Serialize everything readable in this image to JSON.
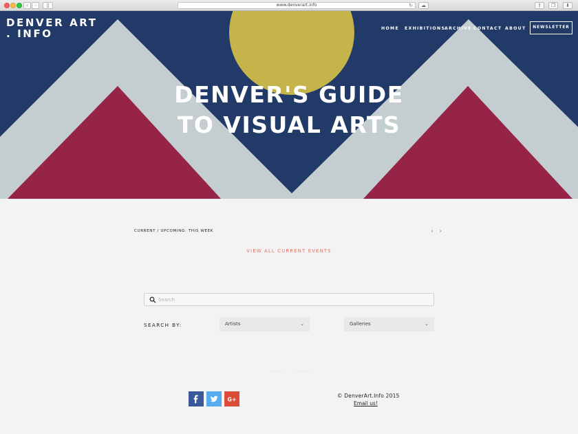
{
  "browser": {
    "url": "www.denverart.info"
  },
  "header": {
    "logo": "DENVER ART . INFO",
    "nav": [
      "HOME",
      "EXHIBITIONS",
      "ARCHIVE",
      "CONTACT",
      "ABOUT"
    ],
    "newsletter_label": "NEWSLETTER"
  },
  "hero": {
    "title_line1": "DENVER'S GUIDE",
    "title_line2": "TO VISUAL ARTS",
    "colors": {
      "sky": "#213a68",
      "sun": "#c4b44a",
      "mountain_outer": "#c4cdd0",
      "mountain_inner": "#962446"
    }
  },
  "events": {
    "label": "CURRENT / UPCOMING: THIS WEEK",
    "prev_icon": "chevron-left-icon",
    "next_icon": "chevron-right-icon",
    "view_all_label": "VIEW ALL CURRENT EVENTS"
  },
  "search": {
    "placeholder": "Search",
    "value": "",
    "search_by_label": "SEARCH BY:",
    "dropdowns": [
      {
        "selected": "Artists"
      },
      {
        "selected": "Galleries"
      }
    ]
  },
  "footer": {
    "ghost_links": [
      "HOME",
      "SUBMIT"
    ],
    "social": [
      {
        "name": "facebook",
        "icon": "facebook-icon",
        "color": "#3b5998"
      },
      {
        "name": "twitter",
        "icon": "twitter-icon",
        "color": "#55acee"
      },
      {
        "name": "google-plus",
        "icon": "google-plus-icon",
        "color": "#dd4b39"
      }
    ],
    "copyright": "©  DenverArt.Info  2015",
    "email_label": "Email us!"
  },
  "accent_color": "#e2705d"
}
